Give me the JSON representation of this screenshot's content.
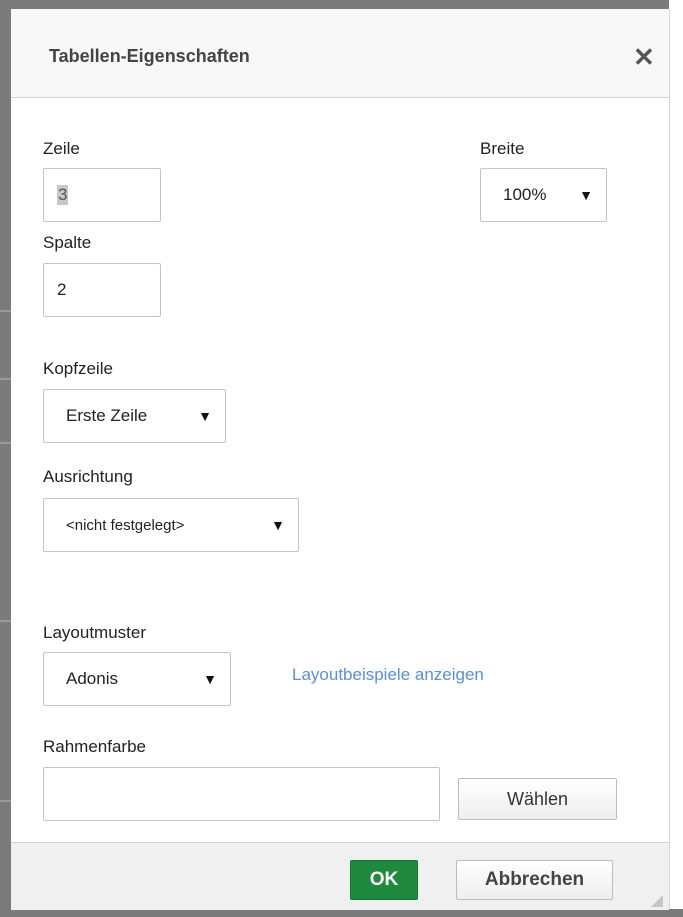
{
  "dialog": {
    "title": "Tabellen-Eigenschaften",
    "close_icon": "close-icon"
  },
  "fields": {
    "rows": {
      "label": "Zeile",
      "value": "3"
    },
    "columns": {
      "label": "Spalte",
      "value": "2"
    },
    "width": {
      "label": "Breite",
      "selected": "100%"
    },
    "header_row": {
      "label": "Kopfzeile",
      "selected": "Erste Zeile"
    },
    "alignment": {
      "label": "Ausrichtung",
      "selected": "<nicht festgelegt>"
    },
    "layout_pattern": {
      "label": "Layoutmuster",
      "selected": "Adonis",
      "examples_link": "Layoutbeispiele anzeigen"
    },
    "border_color": {
      "label": "Rahmenfarbe",
      "value": "",
      "choose_label": "Wählen"
    }
  },
  "footer": {
    "ok_label": "OK",
    "cancel_label": "Abbrechen"
  },
  "icons": {
    "dropdown": "caret-down-icon",
    "resize": "resize-grip-icon"
  },
  "colors": {
    "ok_button": "#1f8a3d",
    "link": "#5b8fd6"
  }
}
